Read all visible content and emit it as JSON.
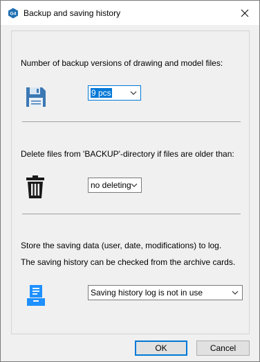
{
  "window": {
    "title": "Backup and saving history",
    "app_icon_text": "G4"
  },
  "backup_versions": {
    "label": "Number of backup versions of drawing and model files:",
    "icon": "floppy-disk-icon",
    "selected": "9 pcs"
  },
  "delete_files": {
    "label": "Delete files from 'BACKUP'-directory if files are older than:",
    "icon": "trash-icon",
    "selected": "no deleting"
  },
  "saving_history": {
    "label_line1": "Store the saving data (user, date, modifications) to log.",
    "label_line2": "The saving history can be checked from the archive cards.",
    "icon": "log-document-icon",
    "selected": "Saving history log is not in use"
  },
  "buttons": {
    "ok": "OK",
    "cancel": "Cancel"
  },
  "colors": {
    "accent": "#0078d7",
    "app_icon_bg": "#1f6fb2",
    "trash": "#1a1a1a",
    "floppy": "#3c78b4",
    "log_icon": "#1e90ff"
  }
}
